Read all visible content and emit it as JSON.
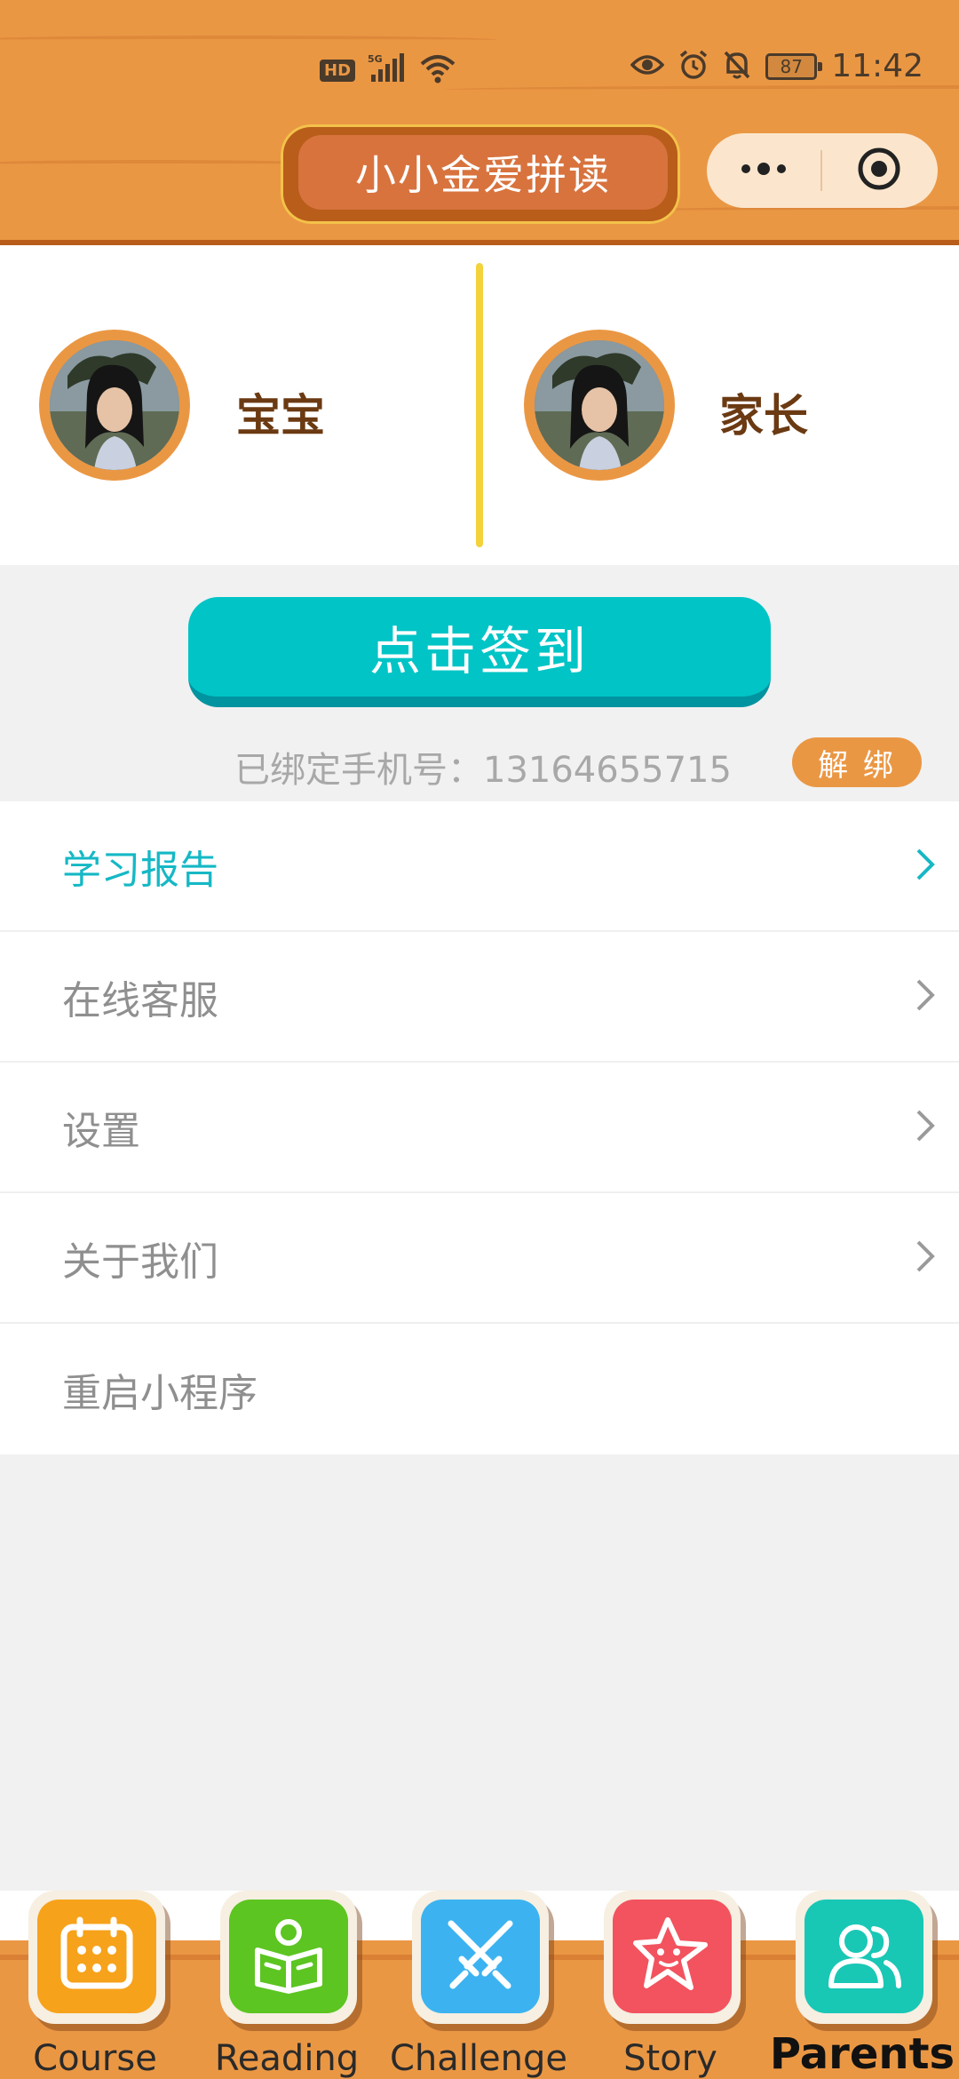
{
  "status_bar": {
    "network": "5G",
    "hd": "HD",
    "battery": "87",
    "time": "11:42"
  },
  "header": {
    "title": "小小金爱拼读"
  },
  "profiles": {
    "baby": {
      "name": "宝宝"
    },
    "parent": {
      "name": "家长"
    }
  },
  "signin": {
    "button_label": "点击签到",
    "bound_phone_text": "已绑定手机号：13164655715",
    "unbind_label": "解 绑"
  },
  "menu": {
    "items": [
      {
        "label": "学习报告",
        "active": true
      },
      {
        "label": "在线客服"
      },
      {
        "label": "设置"
      },
      {
        "label": "关于我们"
      },
      {
        "label": "重启小程序"
      }
    ]
  },
  "tabs": [
    {
      "label": "Course",
      "icon": "calendar-icon",
      "color": "#f7a21b"
    },
    {
      "label": "Reading",
      "icon": "book-reader-icon",
      "color": "#5cc521"
    },
    {
      "label": "Challenge",
      "icon": "crossed-swords-icon",
      "color": "#3cb3f0"
    },
    {
      "label": "Story",
      "icon": "star-face-icon",
      "color": "#f2535e"
    },
    {
      "label": "Parents",
      "icon": "users-icon",
      "color": "#19c7b5",
      "active": true
    }
  ],
  "colors": {
    "wood": "#ea9744",
    "teal": "#00c4c6",
    "accent_text": "#15b8c5"
  }
}
